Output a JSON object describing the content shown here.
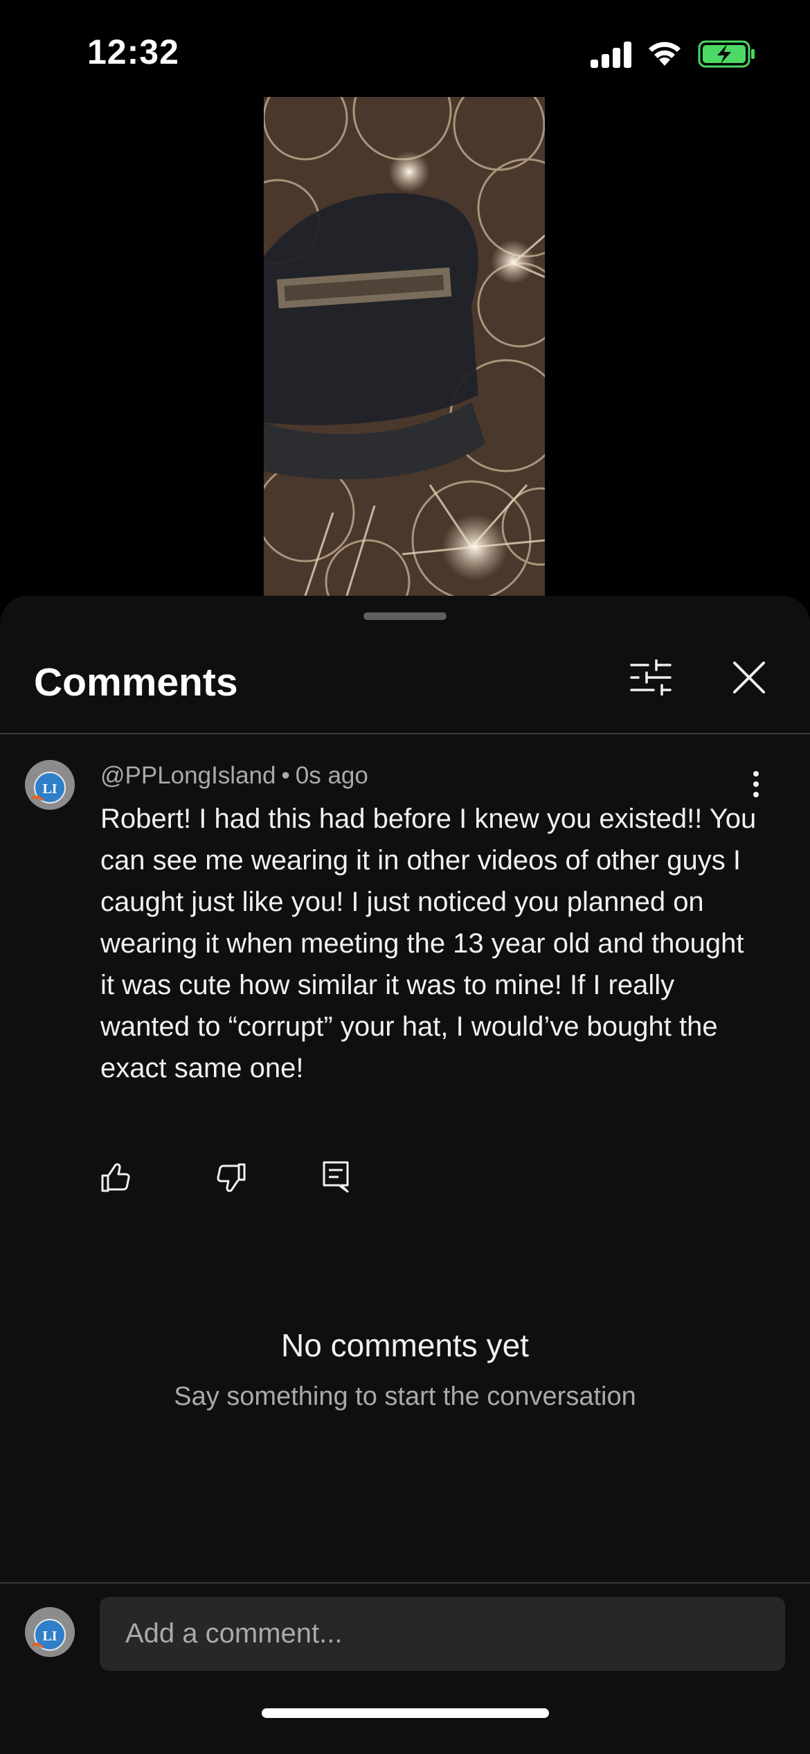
{
  "status_bar": {
    "time": "12:32",
    "icons": [
      "signal-icon",
      "wifi-icon",
      "battery-charging-icon"
    ],
    "battery_color": "#4cd964"
  },
  "video": {
    "description_icon": "video-thumbnail"
  },
  "comments_panel": {
    "title": "Comments",
    "icons": [
      "filter-icon",
      "close-icon"
    ]
  },
  "comment": {
    "author": "@PPLongIsland",
    "separator": "•",
    "time_ago": "0s ago",
    "avatar_text": "LI",
    "text": "Robert! I had this had before I knew you existed!! You can see me wearing it in other videos of other guys I caught just like you! I just noticed you planned on wearing it when meeting the 13 year old and thought it was cute how similar it was to mine! If I really wanted to “corrupt” your hat, I would’ve bought the exact same one!",
    "actions": [
      "like-icon",
      "dislike-icon",
      "reply-icon"
    ]
  },
  "empty_state": {
    "title": "No comments yet",
    "subtitle": "Say something to start the conversation"
  },
  "composer": {
    "placeholder": "Add a comment...",
    "avatar_text": "LI"
  },
  "colors": {
    "background": "#000000",
    "sheet": "#0f0f0f",
    "input": "#272727",
    "secondary_text": "#aaaaaa"
  }
}
